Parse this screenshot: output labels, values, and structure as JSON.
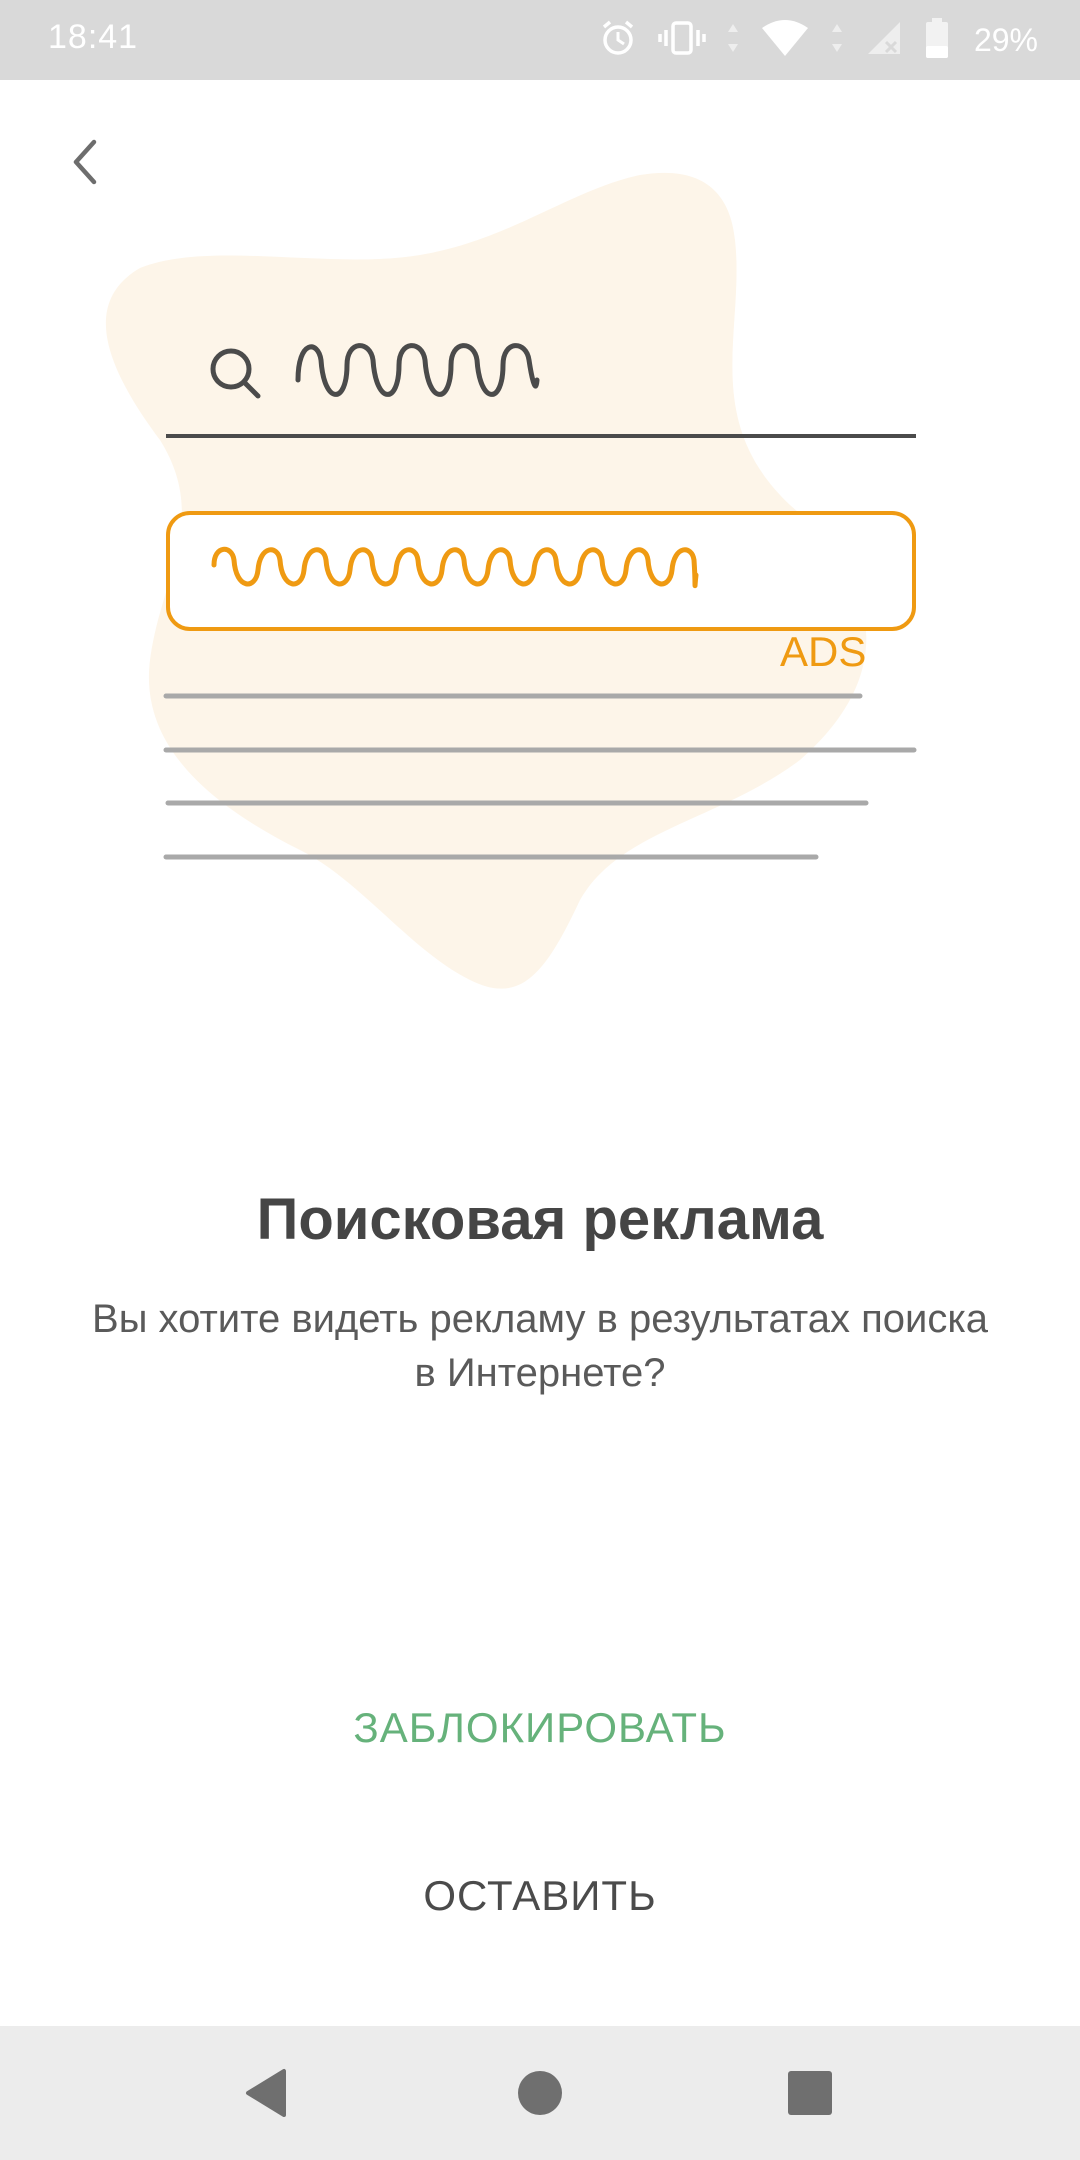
{
  "status_bar": {
    "time": "18:41",
    "battery_percent": "29%",
    "icons": [
      "alarm-icon",
      "vibrate-icon",
      "wifi-icon",
      "signal-icon",
      "battery-icon"
    ],
    "battery_level": 0.29
  },
  "header": {
    "back_icon": "chevron-left-icon"
  },
  "illustration": {
    "ads_label": "ADS",
    "accent_color": "#ef9a12",
    "blob_color": "#fdf5e9"
  },
  "content": {
    "title": "Поисковая реклама",
    "subtitle": "Вы хотите видеть рекламу в результатах поиска в Интернете?"
  },
  "actions": {
    "block_label": "ЗАБЛОКИРОВАТЬ",
    "keep_label": "ОСТАВИТЬ",
    "block_color": "#66b27b"
  },
  "nav_bar": {
    "icons": [
      "back-triangle-icon",
      "home-circle-icon",
      "recents-square-icon"
    ]
  }
}
